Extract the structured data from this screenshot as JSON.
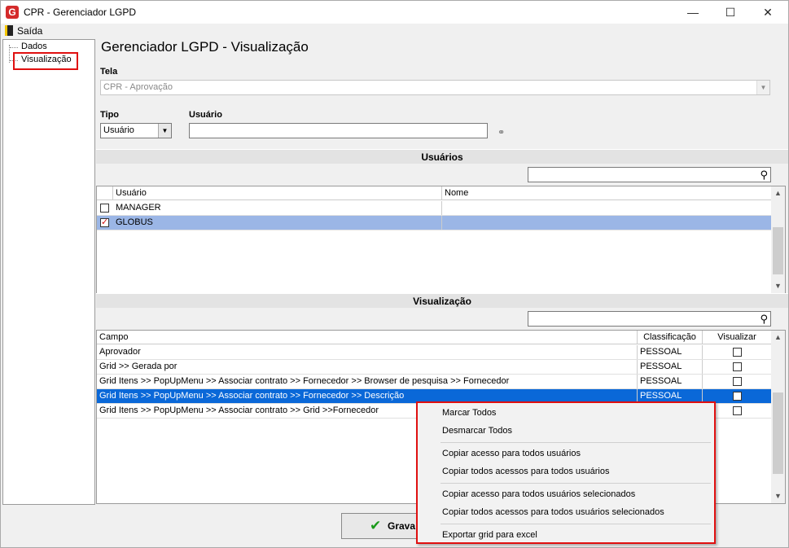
{
  "window": {
    "title": "CPR - Gerenciador LGPD",
    "app_icon": "G",
    "minimize_glyph": "—",
    "maximize_glyph": "☐",
    "close_glyph": "✕"
  },
  "menu": {
    "exit_label": "Saída"
  },
  "tree": {
    "items": [
      {
        "label": "Dados"
      },
      {
        "label": "Visualização",
        "highlighted": true
      }
    ]
  },
  "main": {
    "title": "Gerenciador LGPD - Visualização",
    "tela_label": "Tela",
    "tela_value": "CPR - Aprovação",
    "tipo_label": "Tipo",
    "tipo_value": "Usuário",
    "usuario_label": "Usuário",
    "usuario_value": ""
  },
  "users_section": {
    "header": "Usuários",
    "search_value": "",
    "columns": [
      "Usuário",
      "Nome"
    ],
    "rows": [
      {
        "usuario": "MANAGER",
        "nome": "",
        "checked": false
      },
      {
        "usuario": "GLOBUS",
        "nome": "",
        "checked": true
      }
    ]
  },
  "view_section": {
    "header": "Visualização",
    "search_value": "",
    "columns": [
      "Campo",
      "Classificação",
      "Visualizar"
    ],
    "rows": [
      {
        "campo": "Aprovador",
        "classificacao": "PESSOAL",
        "visualizar": false
      },
      {
        "campo": "Grid >> Gerada por",
        "classificacao": "PESSOAL",
        "visualizar": false
      },
      {
        "campo": "Grid Itens >> PopUpMenu >> Associar contrato >> Fornecedor >> Browser de pesquisa >> Fornecedor",
        "classificacao": "PESSOAL",
        "visualizar": false
      },
      {
        "campo": "Grid Itens >> PopUpMenu >> Associar contrato >> Fornecedor >> Descrição",
        "classificacao": "PESSOAL",
        "visualizar": false
      },
      {
        "campo": "Grid Itens >> PopUpMenu >> Associar contrato >> Grid >>Fornecedor",
        "classificacao": "",
        "visualizar": false
      }
    ]
  },
  "context_menu": {
    "items": [
      "Marcar Todos",
      "Desmarcar Todos",
      "Copiar acesso para todos usuários",
      "Copiar todos acessos para todos usuários",
      "Copiar acesso para todos usuários selecionados",
      "Copiar todos acessos para todos usuários selecionados",
      "Exportar grid para excel"
    ]
  },
  "footer": {
    "save_label": "Grava"
  },
  "colors": {
    "highlight_red": "#e01010",
    "row_selected": "#0a68d8",
    "row_checked": "#9bb6e6"
  }
}
